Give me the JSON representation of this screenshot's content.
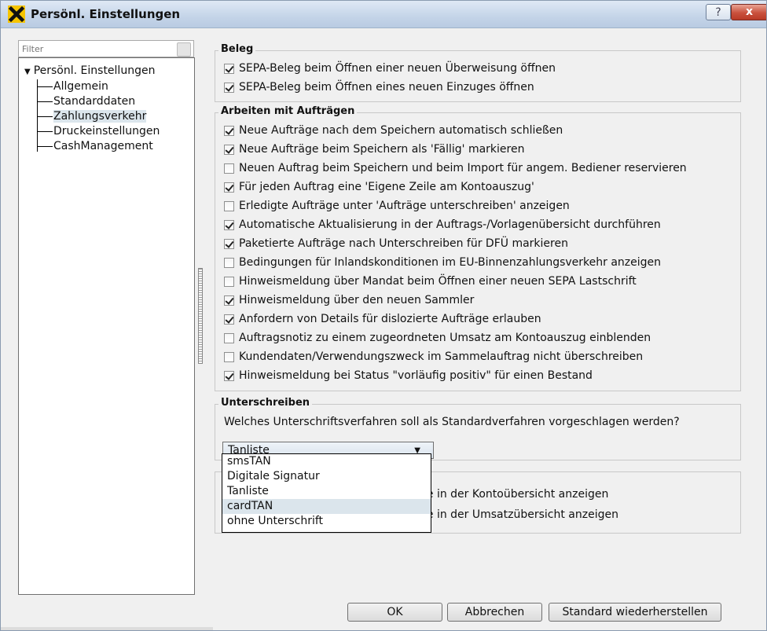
{
  "window": {
    "title": "Persönl. Einstellungen",
    "help_label": "?",
    "close_label": "x",
    "app_icon": "raiffeisen-x-icon",
    "app_icon_color": "#f5c400"
  },
  "sidebar": {
    "filter_placeholder": "Filter",
    "root": "Persönl. Einstellungen",
    "items": [
      {
        "label": "Allgemein"
      },
      {
        "label": "Standarddaten"
      },
      {
        "label": "Zahlungsverkehr"
      },
      {
        "label": "Druckeinstellungen"
      },
      {
        "label": "CashManagement"
      }
    ],
    "selected": "Zahlungsverkehr"
  },
  "beleg": {
    "title": "Beleg",
    "options": [
      {
        "label": "SEPA-Beleg beim Öffnen einer neuen Überweisung öffnen",
        "checked": true
      },
      {
        "label": "SEPA-Beleg beim Öffnen eines neuen Einzuges öffnen",
        "checked": true
      }
    ]
  },
  "auftraege": {
    "title": "Arbeiten mit Aufträgen",
    "options": [
      {
        "label": "Neue Aufträge nach dem Speichern automatisch schließen",
        "checked": true
      },
      {
        "label": "Neue Aufträge beim Speichern als 'Fällig' markieren",
        "checked": true
      },
      {
        "label": "Neuen Auftrag beim Speichern und beim Import für angem. Bediener reservieren",
        "checked": false
      },
      {
        "label": "Für jeden Auftrag eine 'Eigene Zeile am Kontoauszug'",
        "checked": true
      },
      {
        "label": "Erledigte Aufträge unter 'Aufträge unterschreiben' anzeigen",
        "checked": false
      },
      {
        "label": "Automatische Aktualisierung in der Auftrags-/Vorlagenübersicht durchführen",
        "checked": true
      },
      {
        "label": "Paketierte Aufträge nach Unterschreiben für DFÜ markieren",
        "checked": true
      },
      {
        "label": "Bedingungen für Inlandskonditionen im EU-Binnenzahlungsverkehr anzeigen",
        "checked": false
      },
      {
        "label": "Hinweismeldung über Mandat beim Öffnen einer neuen SEPA Lastschrift",
        "checked": false
      },
      {
        "label": "Hinweismeldung über den neuen Sammler",
        "checked": true
      },
      {
        "label": "Anfordern von Details für dislozierte Aufträge erlauben",
        "checked": true
      },
      {
        "label": "Auftragsnotiz zu einem zugeordneten Umsatz am Kontoauszug einblenden",
        "checked": false
      },
      {
        "label": "Kundendaten/Verwendungszweck im Sammelauftrag nicht überschreiben",
        "checked": false
      },
      {
        "label": "Hinweismeldung bei Status \"vorläufig positiv\" für einen Bestand",
        "checked": true
      }
    ]
  },
  "unterschreiben": {
    "title": "Unterschreiben",
    "question": "Welches Unterschriftsverfahren soll als Standardverfahren vorgeschlagen werden?",
    "selected": "Tanliste",
    "options": [
      "smsTAN",
      "Digitale Signatur",
      "Tanliste",
      "cardTAN",
      "ohne Unterschrift"
    ],
    "highlighted": "cardTAN"
  },
  "partial_group": {
    "line1": "ge in der Kontoübersicht anzeigen",
    "line2": "ge in der Umsatzübersicht anzeigen"
  },
  "buttons": {
    "ok": "OK",
    "cancel": "Abbrechen",
    "restore": "Standard wiederherstellen"
  }
}
